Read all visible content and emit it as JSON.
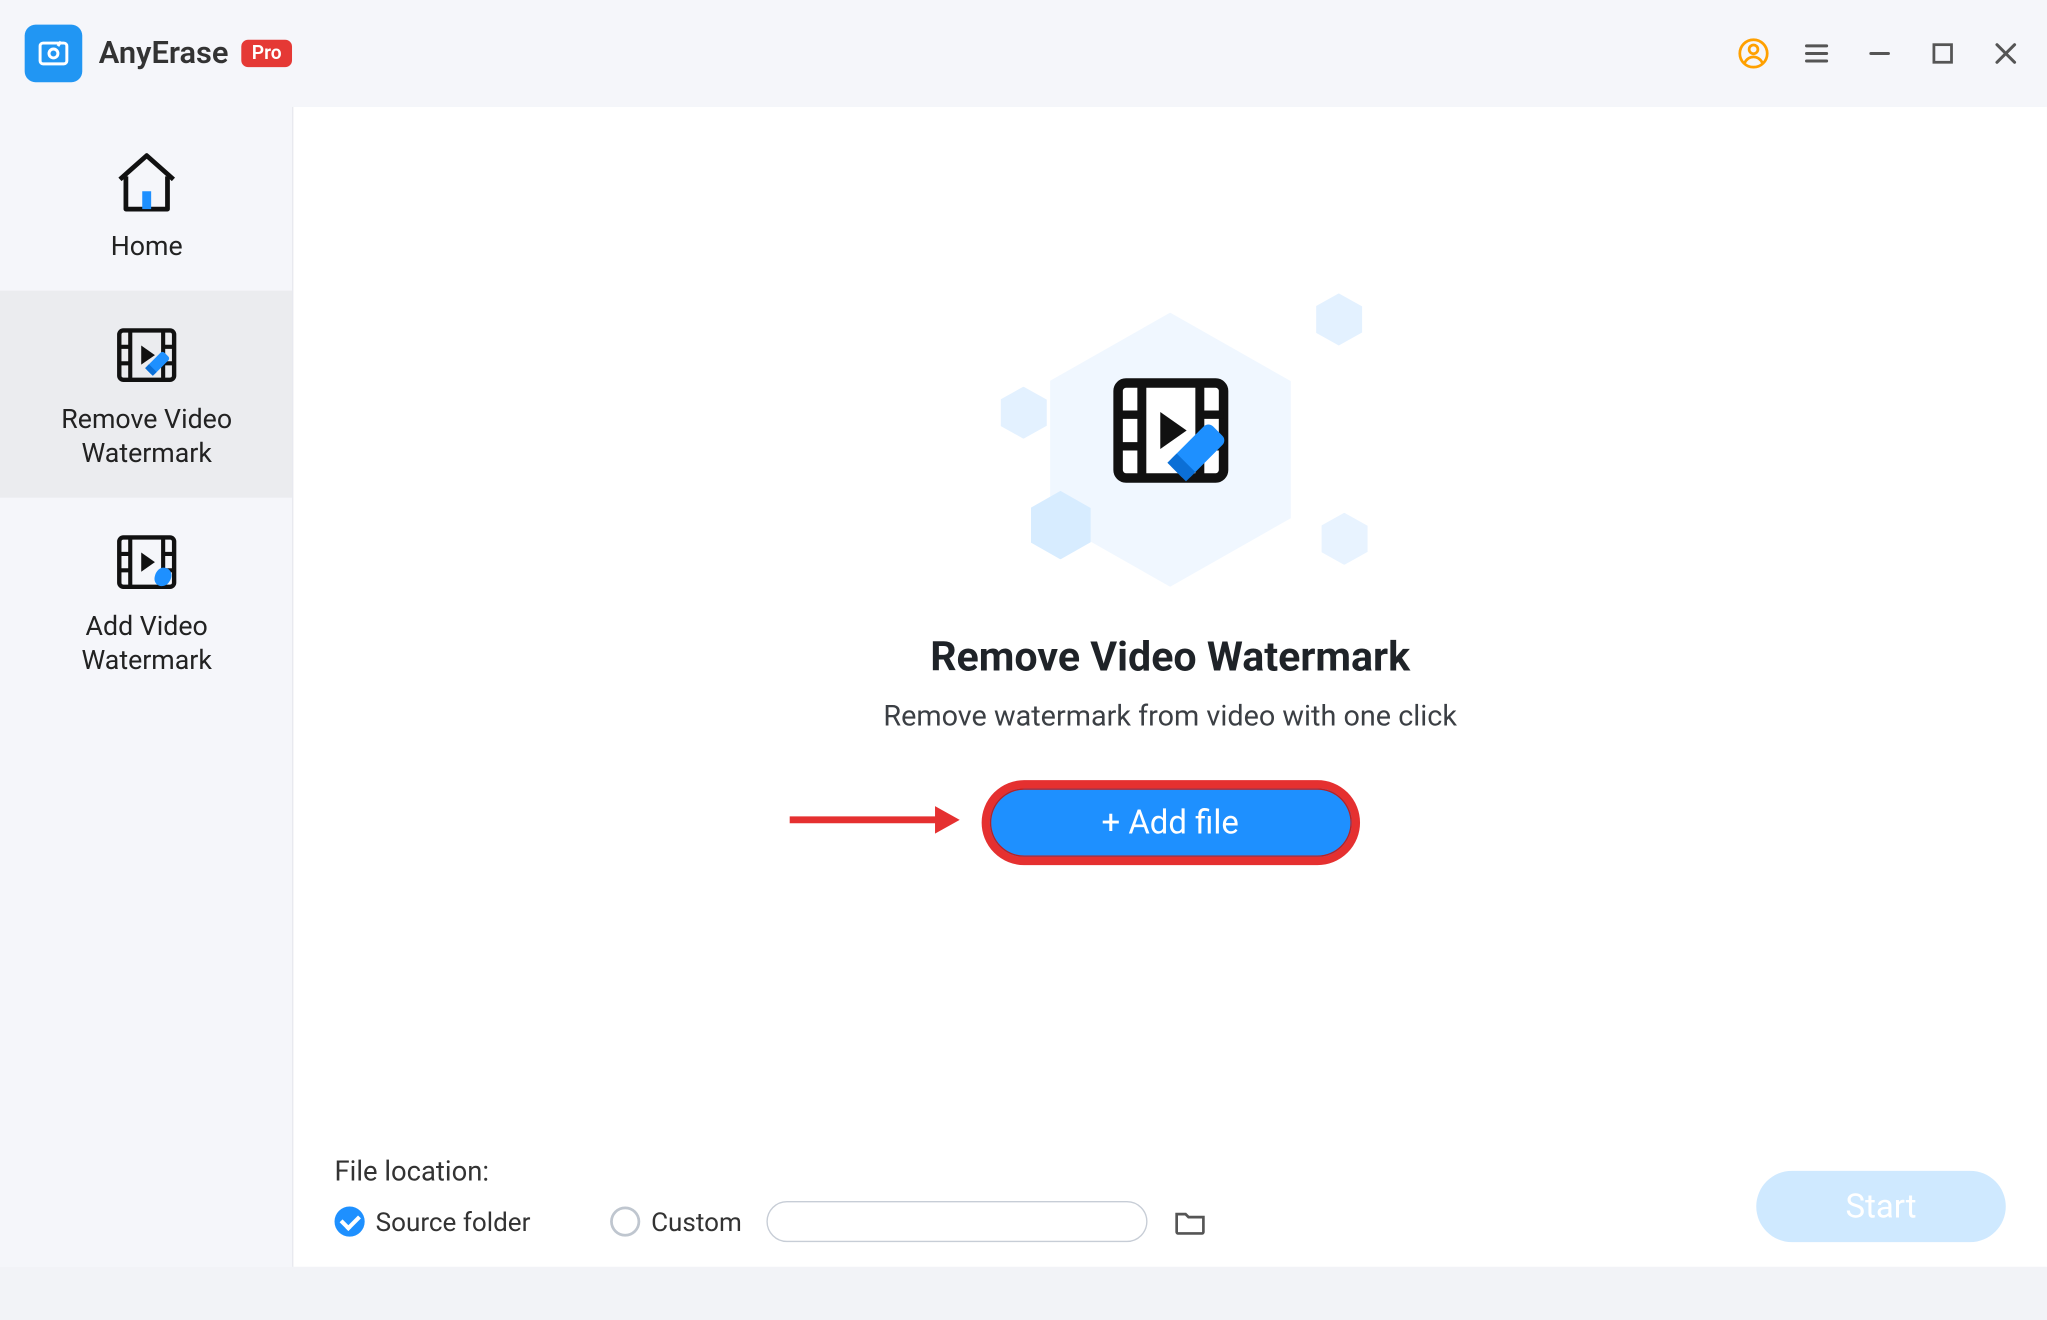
{
  "titlebar": {
    "app_name": "AnyErase",
    "badge": "Pro"
  },
  "sidebar": {
    "items": [
      {
        "label": "Home"
      },
      {
        "label": "Remove Video\nWatermark"
      },
      {
        "label": "Add Video\nWatermark"
      }
    ],
    "active_index": 1
  },
  "hero": {
    "title": "Remove Video Watermark",
    "subtitle": "Remove watermark from video with one click",
    "add_file_label": "+ Add file"
  },
  "bottom": {
    "section_label": "File location:",
    "option_source": "Source folder",
    "option_custom": "Custom",
    "selected": "source",
    "custom_path": "",
    "start_label": "Start"
  },
  "colors": {
    "accent": "#1e90ff",
    "annotation": "#e53030",
    "badge": "#e53935",
    "profile": "#ffa000"
  }
}
